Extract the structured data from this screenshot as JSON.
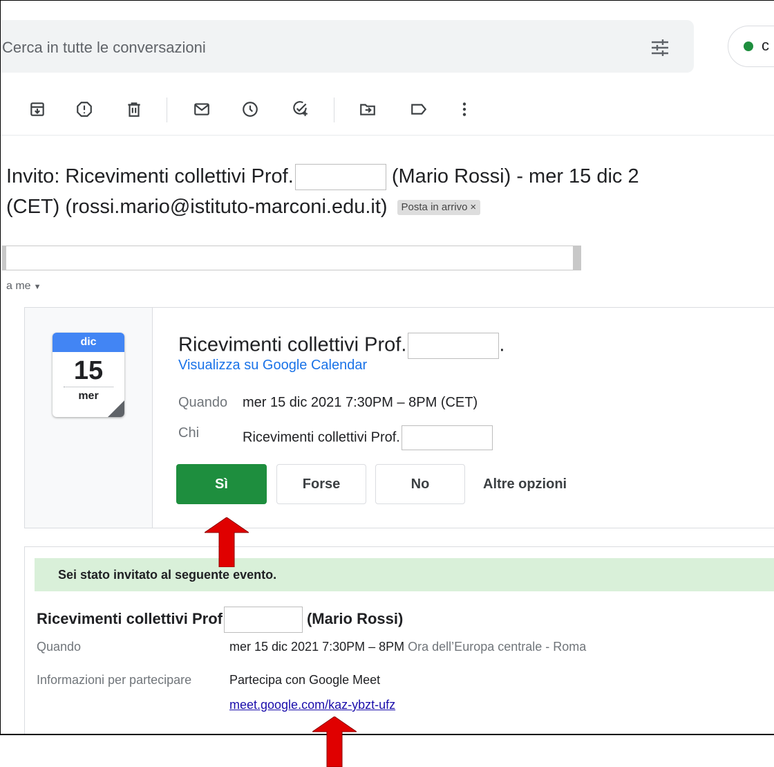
{
  "search": {
    "placeholder": "Cerca in tutte le conversazioni",
    "status_char": "c"
  },
  "toolbar": {
    "icons": [
      "archive-icon",
      "report-spam-icon",
      "delete-icon",
      "mark-unread-icon",
      "snooze-icon",
      "add-to-tasks-icon",
      "move-to-icon",
      "label-icon",
      "more-icon"
    ]
  },
  "message": {
    "subject_part1": "Invito: Ricevimenti collettivi Prof.",
    "subject_part2": " (Mario Rossi) - mer 15 dic 2",
    "subject_part3": "(CET) (rossi.mario@istituto-marconi.edu.it)",
    "label": "Posta in arrivo",
    "label_remove": "×",
    "to": "a me"
  },
  "invite": {
    "month": "dic",
    "day": "15",
    "weekday": "mer",
    "title": "Ricevimenti collettivi Prof.",
    "title_suffix": ".",
    "calendar_link": "Visualizza su Google Calendar",
    "when_label": "Quando",
    "when_value": "mer 15 dic 2021 7:30PM – 8PM (CET)",
    "who_label": "Chi",
    "who_value": "Ricevimenti collettivi Prof.",
    "btn_yes": "Sì",
    "btn_maybe": "Forse",
    "btn_no": "No",
    "more_options": "Altre opzioni"
  },
  "details": {
    "banner": "Sei stato invitato al seguente evento.",
    "title_part1": "Ricevimenti collettivi Prof",
    "title_part2": "(Mario Rossi)",
    "when_label": "Quando",
    "when_value": "mer 15 dic 2021 7:30PM – 8PM",
    "when_tz": "Ora dell’Europa centrale - Roma",
    "join_label": "Informazioni per partecipare",
    "join_value": "Partecipa con Google Meet",
    "meet_link": "meet.google.com/kaz-ybzt-ufz"
  },
  "colors": {
    "accept_green": "#1e8e3e",
    "banner_green": "#d9f0d9",
    "link_blue": "#1a73e8",
    "arrow_red": "#e00000"
  }
}
